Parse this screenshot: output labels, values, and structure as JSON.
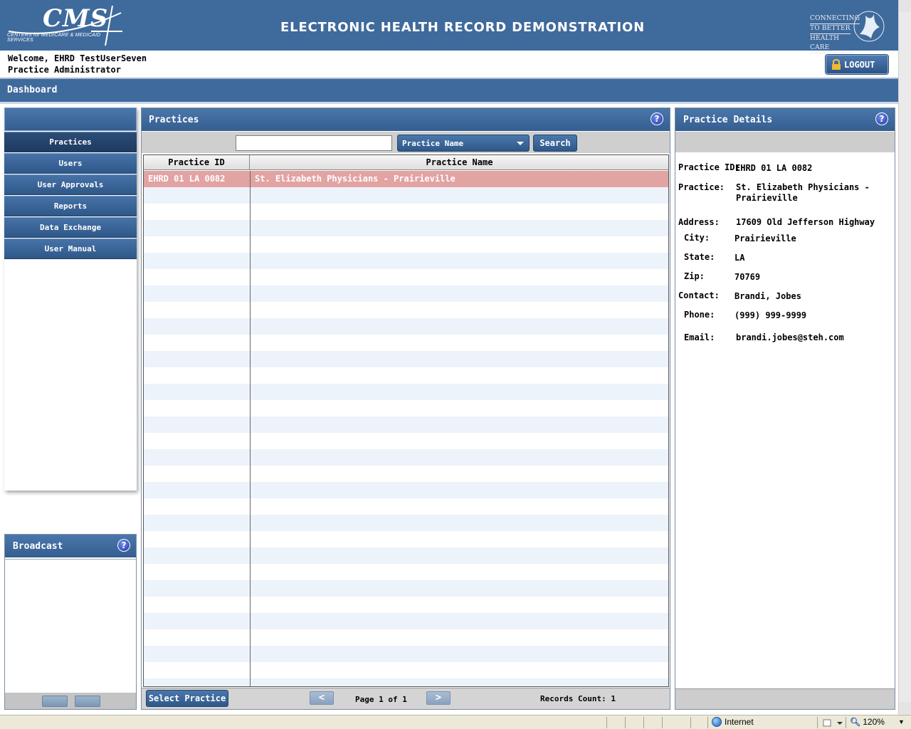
{
  "header": {
    "logo_text": "CMS",
    "logo_subtext": "CENTERS for MEDICARE & MEDICAID SERVICES",
    "title": "ELECTRONIC HEALTH RECORD DEMONSTRATION",
    "hhs_line1": "CONNECTING",
    "hhs_line2": "TO BETTER",
    "hhs_line3": "HEALTH CARE"
  },
  "user": {
    "welcome": "Welcome, EHRD TestUserSeven",
    "role": "Practice Administrator",
    "logout_label": "LOGOUT"
  },
  "breadcrumb": {
    "title": "Dashboard"
  },
  "nav": {
    "items": [
      {
        "label": "Practices",
        "active": true
      },
      {
        "label": "Users"
      },
      {
        "label": "User Approvals"
      },
      {
        "label": "Reports"
      },
      {
        "label": "Data Exchange"
      },
      {
        "label": "User Manual"
      }
    ]
  },
  "broadcast": {
    "title": "Broadcast"
  },
  "practices": {
    "title": "Practices",
    "search_value": "",
    "filter_selected": "Practice Name",
    "search_label": "Search",
    "columns": [
      "Practice ID",
      "Practice Name"
    ],
    "rows": [
      {
        "id": "EHRD 01 LA 0082",
        "name": "St. Elizabeth Physicians - Prairieville",
        "selected": true
      }
    ],
    "select_label": "Select Practice",
    "prev_icon": "<",
    "next_icon": ">",
    "page_info": "Page 1 of 1",
    "records_count": "Records Count: 1"
  },
  "details": {
    "title": "Practice Details",
    "practice_id_label": "Practice ID:",
    "practice_id": "EHRD 01 LA 0082",
    "practice_label": "Practice:",
    "practice_line1": "St. Elizabeth Physicians -",
    "practice_line2": "Prairieville",
    "address_label": "Address:",
    "address": "17609 Old Jefferson Highway",
    "city_label": "City:",
    "city": "Prairieville",
    "state_label": "State:",
    "state": "LA",
    "zip_label": "Zip:",
    "zip": "70769",
    "contact_label": "Contact:",
    "contact": "Brandi, Jobes",
    "phone_label": "Phone:",
    "phone": "(999) 999-9999",
    "email_label": "Email:",
    "email": "brandi.jobes@steh.com"
  },
  "statusbar": {
    "zone": "Internet",
    "zoom": "120%"
  },
  "colors": {
    "header_blue": "#3f6a9c",
    "selected_row": "#e2a3a3",
    "alt_row": "#edf3fa"
  }
}
